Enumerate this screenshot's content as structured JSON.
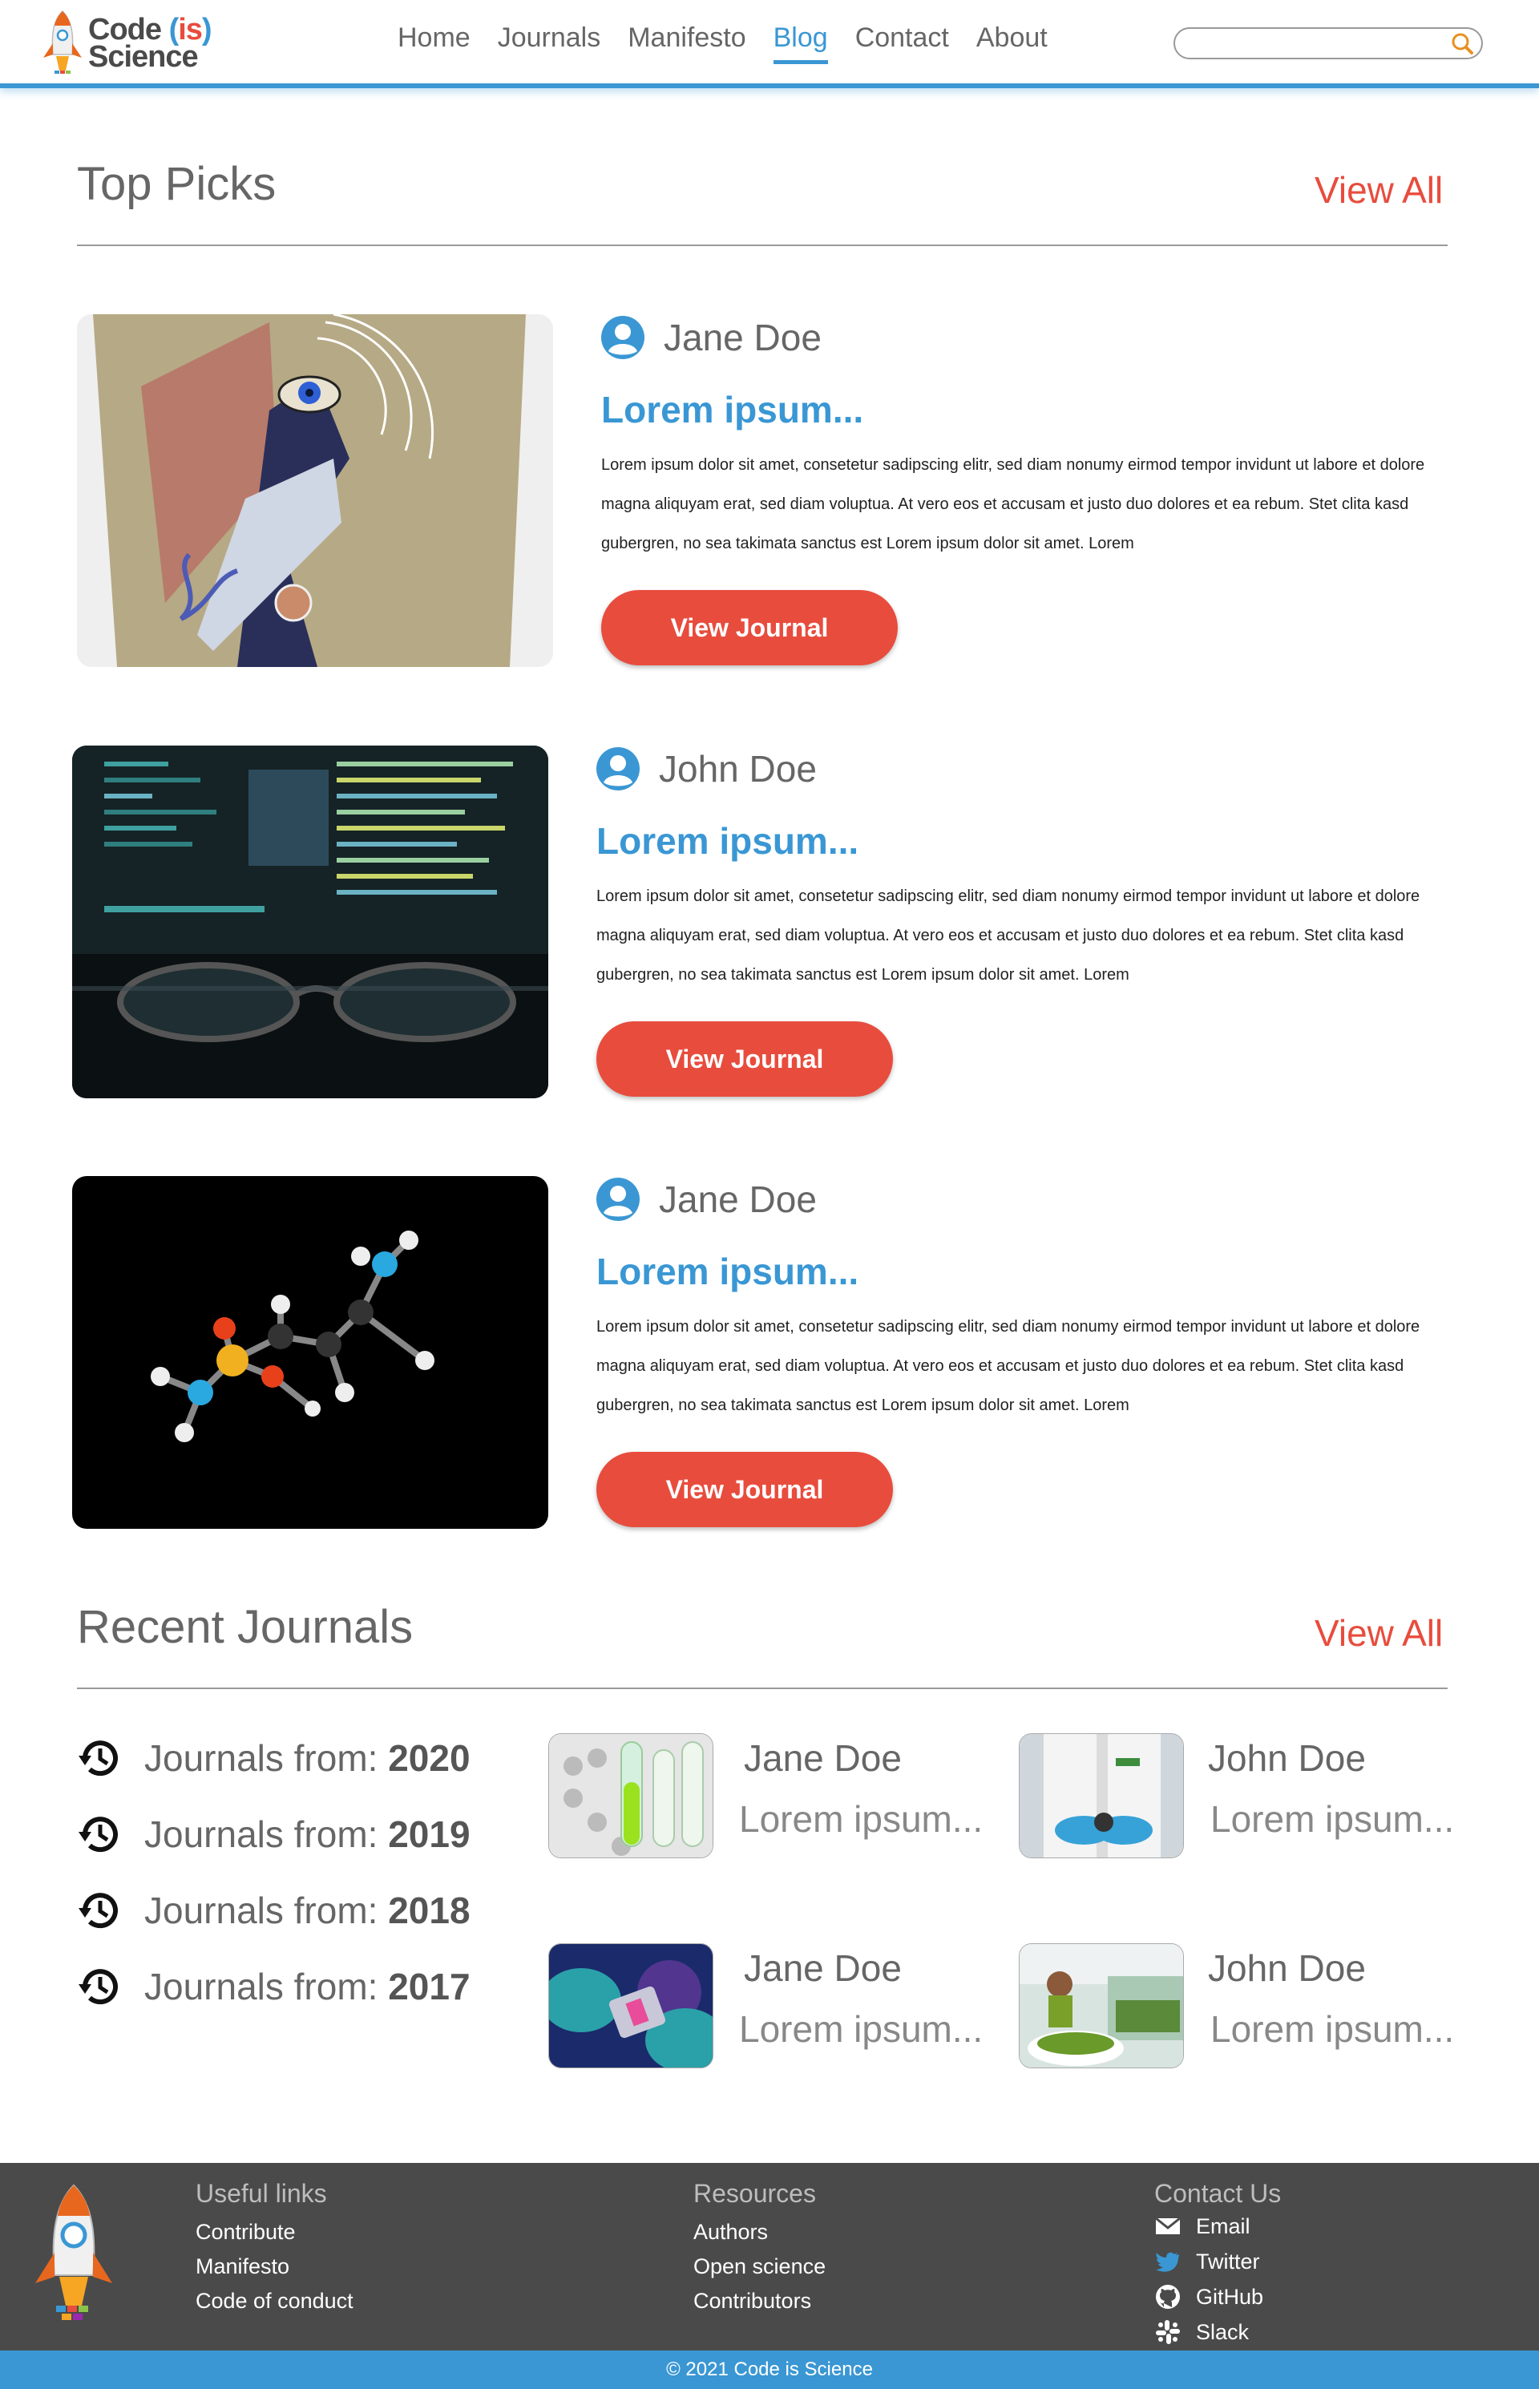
{
  "brand": {
    "logo_code": "Code",
    "logo_is": "is",
    "logo_science": "Science"
  },
  "nav": {
    "items": [
      "Home",
      "Journals",
      "Manifesto",
      "Blog",
      "Contact",
      "About"
    ],
    "active": "Blog"
  },
  "search": {
    "placeholder": "",
    "icon": "search-icon"
  },
  "top_picks": {
    "title": "Top Picks",
    "view_all": "View All",
    "items": [
      {
        "author": "Jane Doe",
        "title": "Lorem ipsum...",
        "description": "Lorem ipsum dolor sit amet, consetetur sadipscing elitr, sed diam nonumy eirmod tempor invidunt ut labore et dolore magna aliquyam erat, sed diam voluptua. At vero eos et accusam et justo duo dolores et ea rebum. Stet clita kasd gubergren, no sea takimata sanctus est Lorem ipsum dolor sit amet. Lorem",
        "button": "View Journal",
        "image": "abstract-eye-art"
      },
      {
        "author": "John Doe",
        "title": "Lorem ipsum...",
        "description": "Lorem ipsum dolor sit amet, consetetur sadipscing elitr, sed diam nonumy eirmod tempor invidunt ut labore et dolore magna aliquyam erat, sed diam voluptua. At vero eos et accusam et justo duo dolores et ea rebum. Stet clita kasd gubergren, no sea takimata sanctus est Lorem ipsum dolor sit amet. Lorem",
        "button": "View Journal",
        "image": "code-screen-glasses"
      },
      {
        "author": "Jane Doe",
        "title": "Lorem ipsum...",
        "description": "Lorem ipsum dolor sit amet, consetetur sadipscing elitr, sed diam nonumy eirmod tempor invidunt ut labore et dolore magna aliquyam erat, sed diam voluptua. At vero eos et accusam et justo duo dolores et ea rebum. Stet clita kasd gubergren, no sea takimata sanctus est Lorem ipsum dolor sit amet. Lorem",
        "button": "View Journal",
        "image": "molecule-model"
      }
    ]
  },
  "recent_journals": {
    "title": "Recent Journals",
    "view_all": "View All",
    "years_label": "Journals from:",
    "years": [
      "2020",
      "2019",
      "2018",
      "2017"
    ],
    "journals": [
      {
        "author": "Jane Doe",
        "title": "Lorem ipsum...",
        "image": "test-tubes"
      },
      {
        "author": "John Doe",
        "title": "Lorem ipsum...",
        "image": "lab-gloves"
      },
      {
        "author": "Jane Doe",
        "title": "Lorem ipsum...",
        "image": "lab-sample"
      },
      {
        "author": "John Doe",
        "title": "Lorem ipsum...",
        "image": "lab-plants"
      }
    ]
  },
  "footer": {
    "useful_links": {
      "title": "Useful links",
      "links": [
        "Contribute",
        "Manifesto",
        "Code of conduct"
      ]
    },
    "resources": {
      "title": "Resources",
      "links": [
        "Authors",
        "Open science",
        "Contributors"
      ]
    },
    "contact": {
      "title": "Contact Us",
      "links": [
        "Email",
        "Twitter",
        "GitHub",
        "Slack"
      ]
    },
    "copyright": "© 2021 Code is Science"
  },
  "colors": {
    "primary_blue": "#3a97d4",
    "accent_red": "#e84c3d",
    "footer_bg": "#4a4a4a",
    "text_gray": "#666666"
  }
}
